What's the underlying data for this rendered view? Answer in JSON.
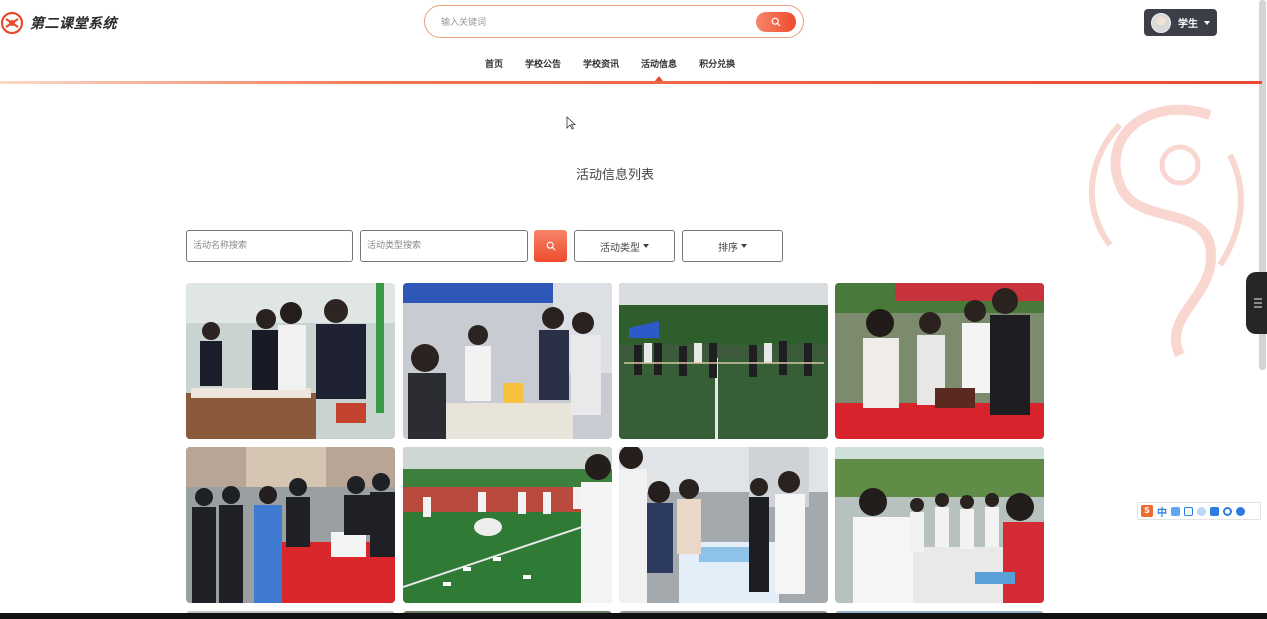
{
  "header": {
    "site_title": "第二课堂系统",
    "search_placeholder": "输入关键词",
    "user_name": "学生",
    "brand_color": "#e84a2e"
  },
  "nav": {
    "items": [
      {
        "label": "首页",
        "active": false
      },
      {
        "label": "学校公告",
        "active": false
      },
      {
        "label": "学校资讯",
        "active": false
      },
      {
        "label": "活动信息",
        "active": true
      },
      {
        "label": "积分兑换",
        "active": false
      }
    ]
  },
  "main": {
    "page_title": "活动信息列表",
    "filters": {
      "name_placeholder": "活动名称搜索",
      "type_placeholder": "活动类型搜索",
      "type_dropdown_label": "活动类型",
      "sort_dropdown_label": "排序"
    },
    "cards": [
      {
        "image": "students-at-booth-table"
      },
      {
        "image": "students-under-tent-stall"
      },
      {
        "image": "tug-of-war-on-field"
      },
      {
        "image": "students-at-red-table"
      },
      {
        "image": "crowd-at-registration-desk"
      },
      {
        "image": "students-game-on-turf"
      },
      {
        "image": "students-at-outdoor-booths"
      },
      {
        "image": "students-signing-at-tables"
      }
    ]
  },
  "ime": {
    "mode_label": "中"
  }
}
